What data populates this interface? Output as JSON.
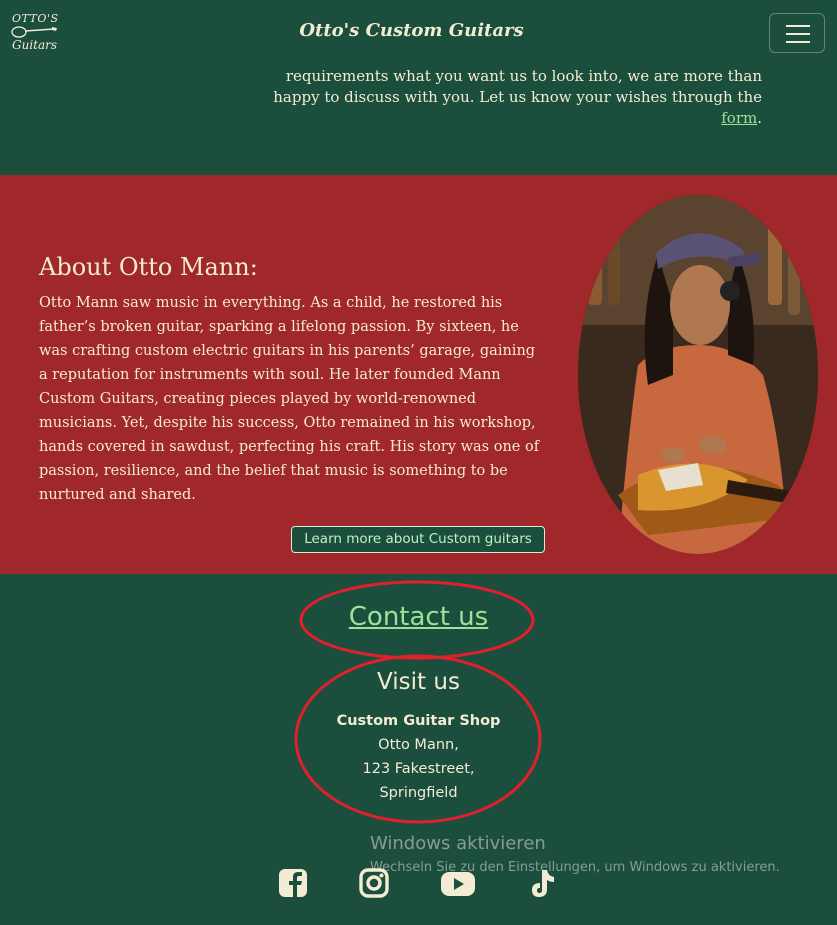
{
  "header": {
    "logo_line1": "OTTO'S",
    "logo_line2": "Guitars",
    "brand": "Otto's Custom Guitars",
    "menu_icon": "hamburger-menu-icon"
  },
  "intro": {
    "text": "requirements what you want us to look into, we are more than happy to discuss with you. Let us know your wishes through the",
    "link": "form",
    "end": "."
  },
  "about": {
    "title": "About Otto Mann:",
    "body": "Otto Mann saw music in everything. As a child, he restored his father’s broken guitar, sparking a lifelong passion. By sixteen, he was crafting custom electric guitars in his parents’ garage, gaining a reputation for instruments with soul. He later founded Mann Custom Guitars, creating pieces played by world-renowned musicians. Yet, despite his success, Otto remained in his workshop, hands covered in sawdust, perfecting his craft. His story was one of passion, resilience, and the belief that music is something to be nurtured and shared.",
    "button": "Learn more about Custom guitars"
  },
  "contact": {
    "link": "Contact us",
    "visit_title": "Visit us",
    "shop": "Custom Guitar Shop",
    "name": "Otto Mann,",
    "street": "123 Fakestreet,",
    "city": "Springfield"
  },
  "watermark": {
    "title": "Windows aktivieren",
    "subtitle": "Wechseln Sie zu den Einstellungen, um Windows zu aktivieren."
  },
  "social": [
    "facebook-icon",
    "instagram-icon",
    "youtube-icon",
    "tiktok-icon"
  ],
  "colors": {
    "background": "#1c4e3e",
    "about_background": "#a0272a",
    "text": "#f3ecd4",
    "link": "#9be39b",
    "annotation": "#e0202a"
  }
}
